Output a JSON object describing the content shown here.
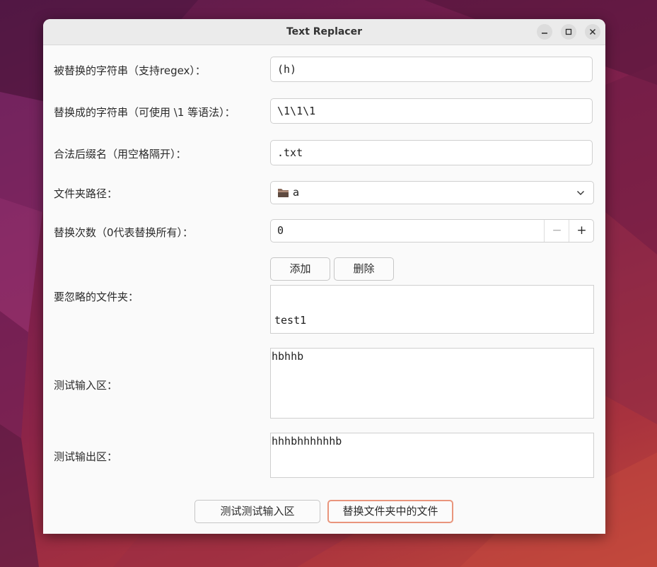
{
  "window": {
    "title": "Text Replacer"
  },
  "form": {
    "search": {
      "label": "被替换的字符串（支持regex）：",
      "value": "(h)"
    },
    "replace": {
      "label": "替换成的字符串（可使用 \\1 等语法）：",
      "value": "\\1\\1\\1"
    },
    "suffix": {
      "label": "合法后缀名（用空格隔开）：",
      "value": ".txt"
    },
    "folder": {
      "label": "文件夹路径：",
      "value": "a",
      "icon": "folder-icon"
    },
    "count": {
      "label": "替换次数（0代表替换所有）：",
      "value": "0",
      "minus": "−",
      "plus": "+"
    },
    "ignore": {
      "add_label": "添加",
      "delete_label": "删除",
      "label": "要忽略的文件夹：",
      "items": [
        "test1"
      ]
    },
    "test_input": {
      "label": "测试输入区：",
      "value": "hbhhb"
    },
    "test_output": {
      "label": "测试输出区：",
      "value": "hhhbhhhhhhb"
    }
  },
  "actions": {
    "test_label": "测试测试输入区",
    "replace_label": "替换文件夹中的文件"
  },
  "colors": {
    "accent_border": "#e9957c",
    "window_bg": "#fafafa",
    "titlebar_bg": "#ebebeb"
  }
}
